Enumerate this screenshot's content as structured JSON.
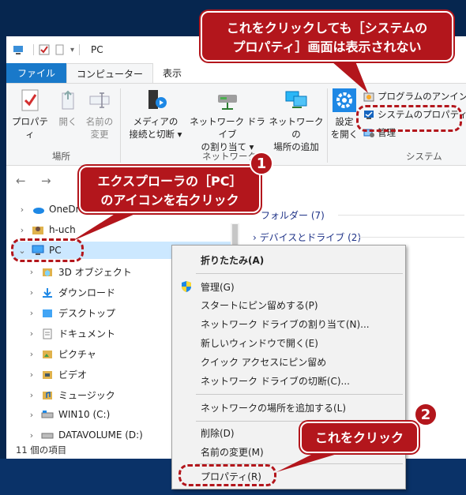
{
  "window": {
    "title": "PC"
  },
  "tabs": [
    "ファイル",
    "コンピューター",
    "表示"
  ],
  "ribbon": {
    "location": {
      "label": "場所",
      "properties": "プロパティ",
      "open": "開く",
      "rename_line1": "名前の",
      "rename_line2": "変更"
    },
    "network": {
      "label": "ネットワーク",
      "media_line1": "メディアの",
      "media_line2": "接続と切断",
      "map_line1": "ネットワーク ドライブ",
      "map_line2": "の割り当て",
      "addloc_line1": "ネットワークの",
      "addloc_line2": "場所の追加"
    },
    "system": {
      "label": "システム",
      "settings_line1": "設定",
      "settings_line2": "を開く",
      "uninstall": "プログラムのアンインス",
      "system_properties": "システムのプロパティ",
      "manage": "管理"
    }
  },
  "nav": {
    "tree": [
      {
        "label": "OneDr",
        "icon": "onedrive-icon"
      },
      {
        "label": "h-uch",
        "icon": "user-folder-icon"
      },
      {
        "label": "PC",
        "icon": "pc-icon"
      },
      {
        "label": "3D オブジェクト",
        "icon": "3d-objects-icon"
      },
      {
        "label": "ダウンロード",
        "icon": "downloads-icon"
      },
      {
        "label": "デスクトップ",
        "icon": "desktop-icon"
      },
      {
        "label": "ドキュメント",
        "icon": "documents-icon"
      },
      {
        "label": "ピクチャ",
        "icon": "pictures-icon"
      },
      {
        "label": "ビデオ",
        "icon": "videos-icon"
      },
      {
        "label": "ミュージック",
        "icon": "music-icon"
      },
      {
        "label": "WIN10 (C:)",
        "icon": "drive-c-icon"
      },
      {
        "label": "DATAVOLUME (D:)",
        "icon": "drive-d-icon"
      }
    ]
  },
  "content": {
    "folders_header": "フォルダー (7)",
    "devices_header": "デバイスとドライブ (2)"
  },
  "status": {
    "item_count": "11 個の項目"
  },
  "context_menu": {
    "items": [
      "折りたたみ(A)",
      "管理(G)",
      "スタートにピン留めする(P)",
      "ネットワーク ドライブの割り当て(N)...",
      "新しいウィンドウで開く(E)",
      "クイック アクセスにピン留め",
      "ネットワーク ドライブの切断(C)...",
      "ネットワークの場所を追加する(L)",
      "削除(D)",
      "名前の変更(M)",
      "プロパティ(R)"
    ]
  },
  "callouts": {
    "top_line1": "これをクリックしても［システムの",
    "top_line2": "プロパティ］画面は表示されない",
    "step1_line1": "エクスプローラの［PC］",
    "step1_line2": "のアイコンを右クリック",
    "step2": "これをクリック",
    "badge1": "1",
    "badge2": "2"
  },
  "colors": {
    "accent": "#1979ca",
    "callout": "#b3161c",
    "selected": "#cce8ff"
  }
}
